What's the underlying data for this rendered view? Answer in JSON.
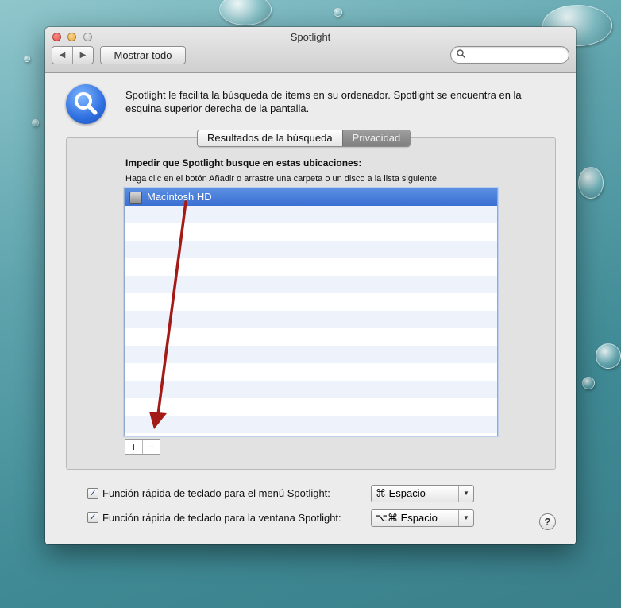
{
  "window": {
    "title": "Spotlight"
  },
  "toolbar": {
    "back_icon": "◀",
    "forward_icon": "▶",
    "show_all_label": "Mostrar todo",
    "search_value": ""
  },
  "description": "Spotlight le facilita la búsqueda de ítems en su ordenador. Spotlight se encuentra en la esquina superior derecha de la pantalla.",
  "tabs": [
    {
      "label": "Resultados de la búsqueda",
      "selected": false
    },
    {
      "label": "Privacidad",
      "selected": true
    }
  ],
  "privacy": {
    "heading": "Impedir que Spotlight busque en estas ubicaciones:",
    "instructions": "Haga clic en el botón Añadir o arrastre una carpeta o un disco a la lista siguiente.",
    "items": [
      {
        "label": "Macintosh HD",
        "selected": true
      }
    ],
    "add_label": "+",
    "remove_label": "−"
  },
  "shortcuts": [
    {
      "label": "Función rápida de teclado para el menú Spotlight:",
      "checked": true,
      "value": "⌘ Espacio"
    },
    {
      "label": "Función rápida de teclado para la ventana Spotlight:",
      "checked": true,
      "value": "⌥⌘ Espacio"
    }
  ],
  "help_label": "?",
  "colors": {
    "accent": "#3a6fd4",
    "annotation_arrow": "#a31a17",
    "close": "#e0443e",
    "minimize": "#dea236",
    "zoom": "#bcbcbc"
  }
}
